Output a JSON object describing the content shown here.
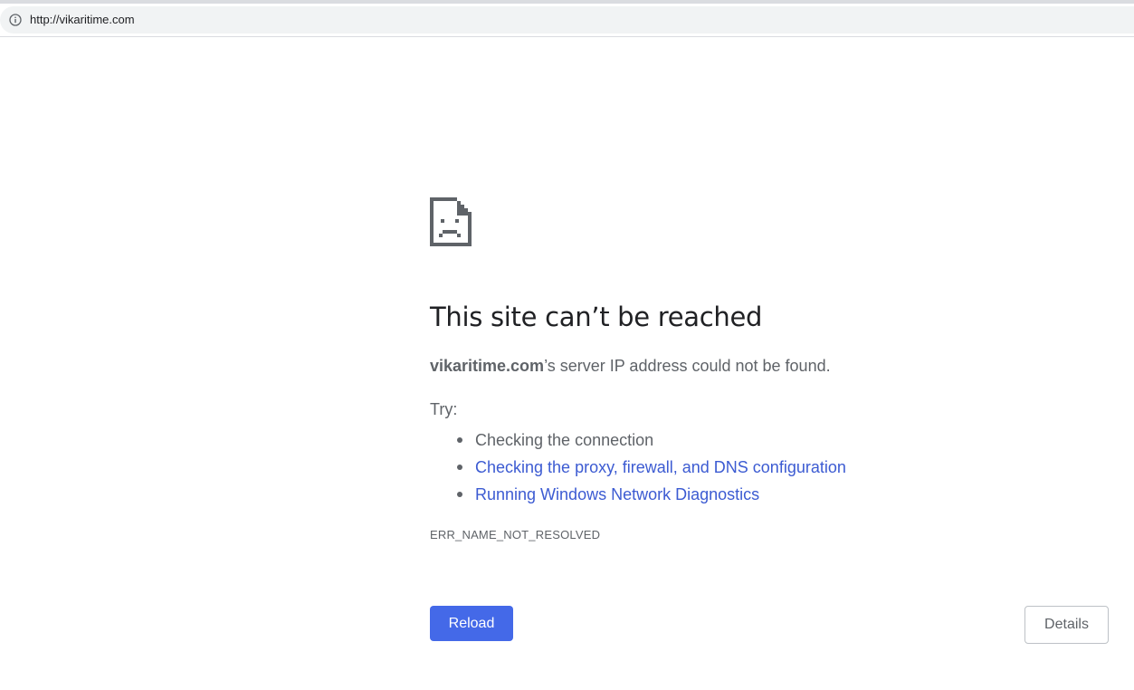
{
  "address_bar": {
    "url": "http://vikaritime.com",
    "info_icon": "info-icon"
  },
  "error_page": {
    "icon": "sad-page-icon",
    "heading": "This site can’t be reached",
    "summary_domain": "vikaritime.com",
    "summary_rest": "’s server IP address could not be found.",
    "try_label": "Try:",
    "suggestions": [
      {
        "text": "Checking the connection",
        "is_link": false
      },
      {
        "text": "Checking the proxy, firewall, and DNS configuration",
        "is_link": true
      },
      {
        "text": "Running Windows Network Diagnostics",
        "is_link": true
      }
    ],
    "error_code": "ERR_NAME_NOT_RESOLVED"
  },
  "buttons": {
    "reload_label": "Reload",
    "details_label": "Details"
  },
  "colors": {
    "accent": "#4469e8",
    "link": "#3c5bd2",
    "text": "#5f6368",
    "heading": "#202124"
  }
}
